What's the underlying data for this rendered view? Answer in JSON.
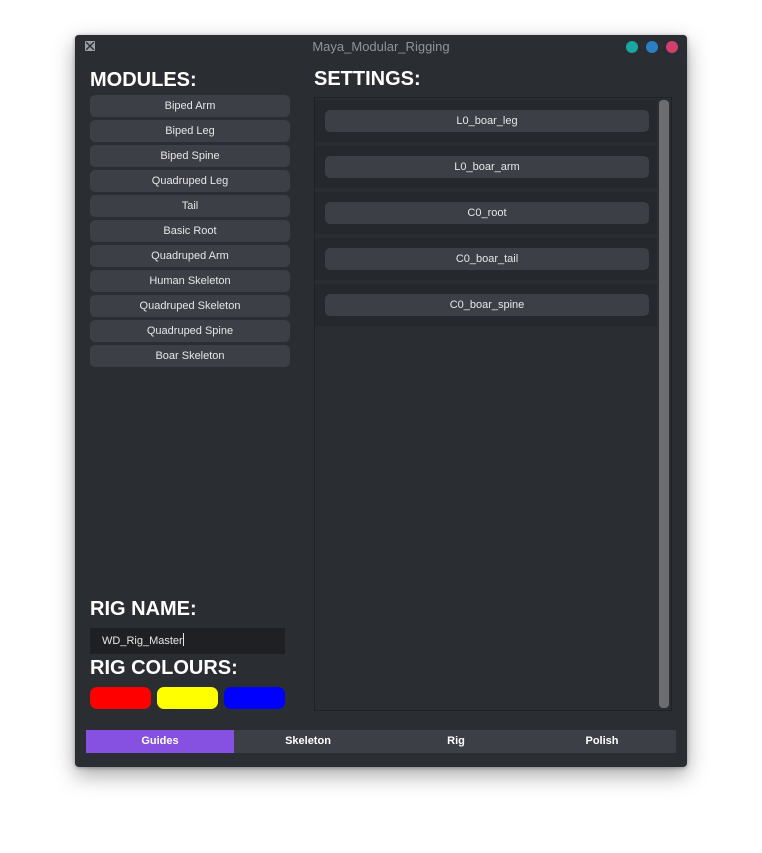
{
  "window": {
    "title": "Maya_Modular_Rigging",
    "controls": [
      "minimize",
      "maximize",
      "close"
    ],
    "control_colors": {
      "minimize": "#1aa7a1",
      "maximize": "#2c7fc2",
      "close": "#d23f6d"
    }
  },
  "modules": {
    "heading": "MODULES:",
    "items": [
      "Biped Arm",
      "Biped Leg",
      "Biped Spine",
      "Quadruped Leg",
      "Tail",
      "Basic Root",
      "Quadruped Arm",
      "Human Skeleton",
      "Quadruped Skeleton",
      "Quadruped Spine",
      "Boar Skeleton"
    ]
  },
  "settings": {
    "heading": "SETTINGS:",
    "items": [
      "L0_boar_leg",
      "L0_boar_arm",
      "C0_root",
      "C0_boar_tail",
      "C0_boar_spine"
    ]
  },
  "rig_name": {
    "heading": "RIG NAME:",
    "value": "WD_Rig_Master"
  },
  "rig_colours": {
    "heading": "RIG COLOURS:",
    "swatches": [
      "#ff0000",
      "#ffff00",
      "#0000ff"
    ]
  },
  "tabs": {
    "items": [
      "Guides",
      "Skeleton",
      "Rig",
      "Polish"
    ],
    "active": "Guides",
    "accent": "#8650e0"
  },
  "icons": {
    "app": "maya-app-icon"
  }
}
